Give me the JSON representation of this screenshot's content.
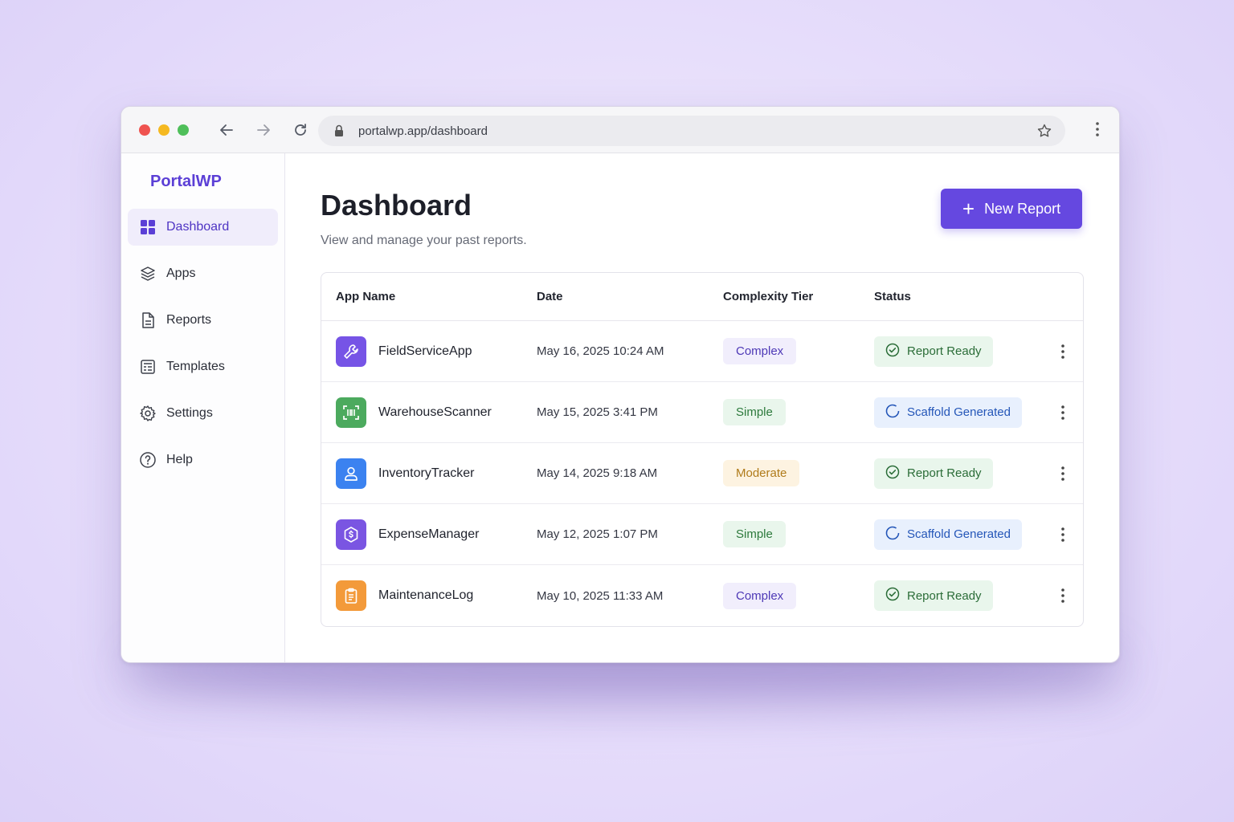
{
  "browser": {
    "url": "portalwp.app/dashboard"
  },
  "sidebar": {
    "brand": "PortalWP",
    "items": [
      {
        "label": "Dashboard",
        "icon": "grid-icon",
        "active": true
      },
      {
        "label": "Apps",
        "icon": "layers-icon"
      },
      {
        "label": "Reports",
        "icon": "document-icon"
      },
      {
        "label": "Templates",
        "icon": "template-icon"
      },
      {
        "label": "Settings",
        "icon": "gear-icon"
      },
      {
        "label": "Help",
        "icon": "help-icon"
      }
    ]
  },
  "header": {
    "title": "Dashboard",
    "subtitle": "View and manage your past reports.",
    "new_button_label": "New Report"
  },
  "table": {
    "columns": [
      "App Name",
      "Date",
      "Complexity Tier",
      "Status"
    ],
    "rows": [
      {
        "name": "FieldServiceApp",
        "date": "May 16, 2025  10:24 AM",
        "tier": "Complex",
        "status": "Report Ready",
        "icon": "wrench-icon",
        "icon_color": "#7654e6"
      },
      {
        "name": "WarehouseScanner",
        "date": "May 15, 2025  3:41 PM",
        "tier": "Simple",
        "status": "Scaffold Generated",
        "icon": "barcode-scan-icon",
        "icon_color": "#4caa5e"
      },
      {
        "name": "InventoryTracker",
        "date": "May 14, 2025  9:18 AM",
        "tier": "Moderate",
        "status": "Report Ready",
        "icon": "user-icon",
        "icon_color": "#3b82f0"
      },
      {
        "name": "ExpenseManager",
        "date": "May 12, 2025  1:07 PM",
        "tier": "Simple",
        "status": "Scaffold Generated",
        "icon": "dollar-shield-icon",
        "icon_color": "#7a55e2"
      },
      {
        "name": "MaintenanceLog",
        "date": "May 10, 2025  11:33 AM",
        "tier": "Complex",
        "status": "Report Ready",
        "icon": "clipboard-icon",
        "icon_color": "#f39a3a"
      }
    ]
  },
  "colors": {
    "accent": "#6548e0",
    "brand": "#5b3fd6"
  }
}
